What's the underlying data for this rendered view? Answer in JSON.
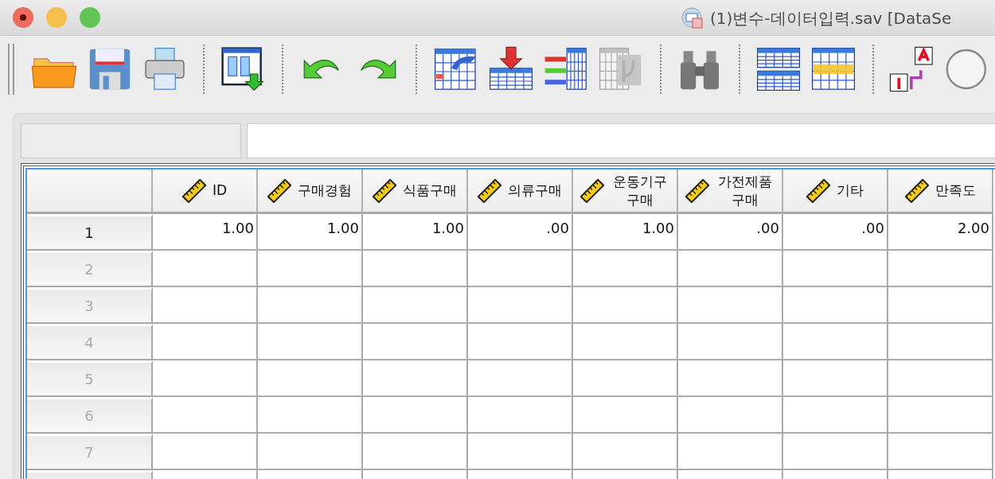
{
  "window": {
    "title": "(1)변수-데이터입력.sav [DataSe"
  },
  "toolbar": [
    {
      "kind": "open",
      "disabled": false
    },
    {
      "kind": "save",
      "disabled": false
    },
    {
      "kind": "print",
      "disabled": false
    },
    {
      "kind": "separator"
    },
    {
      "kind": "recall",
      "disabled": false
    },
    {
      "kind": "separator"
    },
    {
      "kind": "undo",
      "disabled": false
    },
    {
      "kind": "redo",
      "disabled": false
    },
    {
      "kind": "separator"
    },
    {
      "kind": "goto-case",
      "disabled": false
    },
    {
      "kind": "insert-case",
      "disabled": false
    },
    {
      "kind": "variables",
      "disabled": false
    },
    {
      "kind": "statistics",
      "disabled": true
    },
    {
      "kind": "separator"
    },
    {
      "kind": "find",
      "disabled": false
    },
    {
      "kind": "separator"
    },
    {
      "kind": "split",
      "disabled": false
    },
    {
      "kind": "select",
      "disabled": false
    },
    {
      "kind": "separator"
    },
    {
      "kind": "value-labels",
      "disabled": false
    },
    {
      "kind": "sets",
      "disabled": false
    }
  ],
  "grid": {
    "columns": [
      "ID",
      "구매경험",
      "식품구매",
      "의류구매",
      "운동기구 구매",
      "가전제품 구매",
      "기타",
      "만족도"
    ],
    "rows": [
      {
        "number": "1",
        "empty": false,
        "cells": [
          "1.00",
          "1.00",
          "1.00",
          ".00",
          "1.00",
          ".00",
          ".00",
          "2.00"
        ]
      },
      {
        "number": "2",
        "empty": true,
        "cells": []
      },
      {
        "number": "3",
        "empty": true,
        "cells": []
      },
      {
        "number": "4",
        "empty": true,
        "cells": []
      },
      {
        "number": "5",
        "empty": true,
        "cells": []
      },
      {
        "number": "6",
        "empty": true,
        "cells": []
      },
      {
        "number": "7",
        "empty": true,
        "cells": []
      }
    ]
  }
}
